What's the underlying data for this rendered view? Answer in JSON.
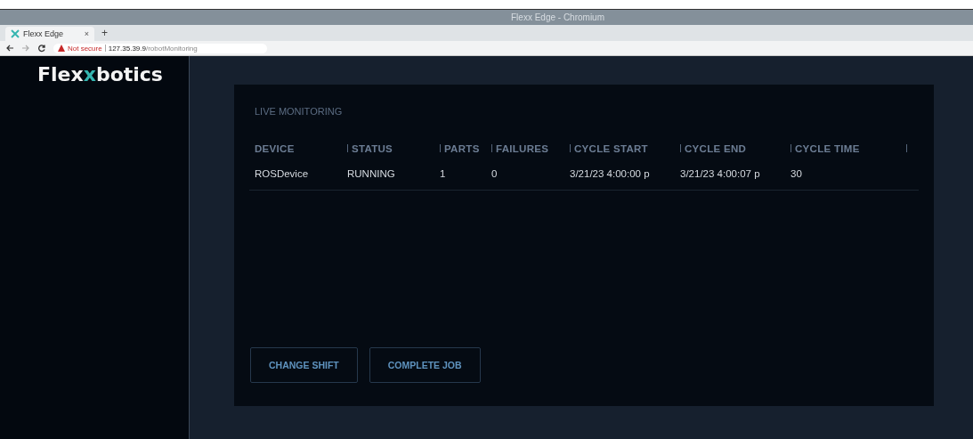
{
  "window": {
    "title": "Flexx Edge - Chromium"
  },
  "tabs": [
    {
      "label": "Flexx Edge",
      "close": "×",
      "selected": true
    }
  ],
  "new_tab": "+",
  "address_bar": {
    "security": "Not secure",
    "host": "127.35.39.9",
    "path": "/robotMonitoring"
  },
  "logo": {
    "before": "Flex",
    "accent": "x",
    "after": "botics"
  },
  "card": {
    "title": "LIVE MONITORING",
    "table": {
      "columns": [
        "DEVICE",
        "STATUS",
        "PARTS",
        "FAILURES",
        "CYCLE START",
        "CYCLE END",
        "CYCLE TIME"
      ],
      "rows": [
        [
          "ROSDevice",
          "RUNNING",
          "1",
          "0",
          "3/21/23 4:00:00 p",
          "3/21/23 4:00:07 p",
          "30"
        ]
      ]
    },
    "buttons": [
      "CHANGE SHIFT",
      "COMPLETE JOB"
    ]
  }
}
